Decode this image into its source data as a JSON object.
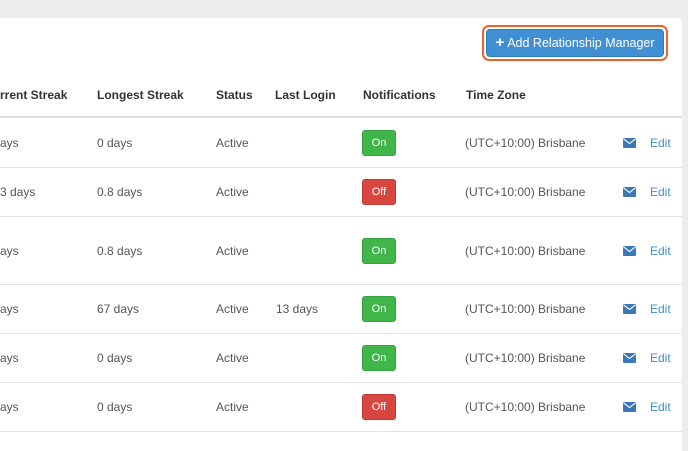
{
  "toolbar": {
    "add_button_label": "Add Relationship Manager",
    "add_button_icon": "plus-icon"
  },
  "table": {
    "headers": {
      "current_streak": "rrent Streak",
      "longest_streak": "Longest Streak",
      "status": "Status",
      "last_login": "Last Login",
      "notifications": "Notifications",
      "time_zone": "Time Zone"
    },
    "rows": [
      {
        "current_streak": "ays",
        "longest_streak": "0 days",
        "status": "Active",
        "last_login": "",
        "notifications": "On",
        "time_zone": "(UTC+10:00) Brisbane",
        "edit": "Edit"
      },
      {
        "current_streak": "3 days",
        "longest_streak": "0.8 days",
        "status": "Active",
        "last_login": "",
        "notifications": "Off",
        "time_zone": "(UTC+10:00) Brisbane",
        "edit": "Edit"
      },
      {
        "current_streak": "ays",
        "longest_streak": "0.8 days",
        "status": "Active",
        "last_login": "",
        "notifications": "On",
        "time_zone": "(UTC+10:00) Brisbane",
        "edit": "Edit"
      },
      {
        "current_streak": "ays",
        "longest_streak": "67 days",
        "status": "Active",
        "last_login": "13 days",
        "notifications": "On",
        "time_zone": "(UTC+10:00) Brisbane",
        "edit": "Edit"
      },
      {
        "current_streak": "ays",
        "longest_streak": "0 days",
        "status": "Active",
        "last_login": "",
        "notifications": "On",
        "time_zone": "(UTC+10:00) Brisbane",
        "edit": "Edit"
      },
      {
        "current_streak": "ays",
        "longest_streak": "0 days",
        "status": "Active",
        "last_login": "",
        "notifications": "Off",
        "time_zone": "(UTC+10:00) Brisbane",
        "edit": "Edit"
      }
    ]
  },
  "colors": {
    "primary": "#3f8fd2",
    "focus_ring": "#e8652d",
    "toggle_on": "#3fb54a",
    "toggle_off": "#d9463f"
  }
}
